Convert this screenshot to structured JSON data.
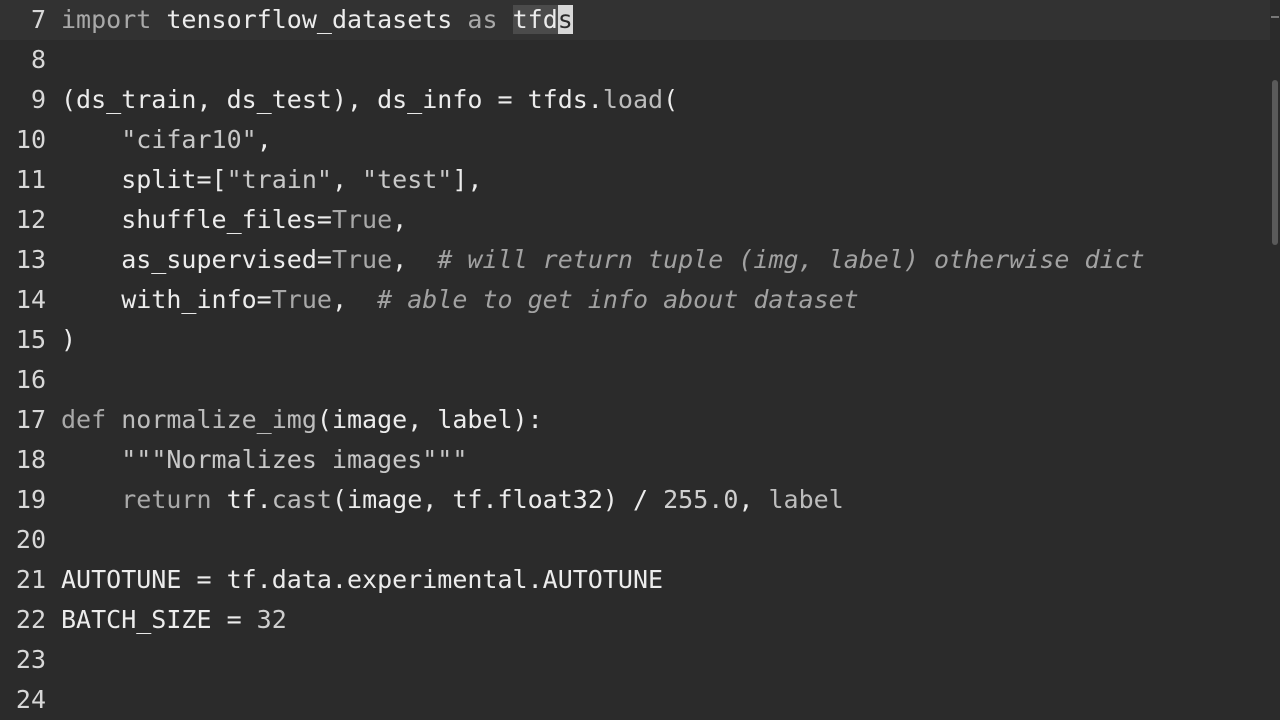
{
  "editor": {
    "language": "python",
    "caret_line": "7",
    "lines": [
      {
        "num": "7",
        "tokens": [
          {
            "t": "import",
            "c": "kw"
          },
          {
            "t": " ",
            "c": "id"
          },
          {
            "t": "tensorflow_datasets",
            "c": "id"
          },
          {
            "t": " ",
            "c": "id"
          },
          {
            "t": "as",
            "c": "kw"
          },
          {
            "t": " ",
            "c": "id"
          },
          {
            "t": "tfd",
            "c": "id sel-word"
          },
          {
            "t": "s",
            "c": "caret-box"
          }
        ]
      },
      {
        "num": "8",
        "tokens": []
      },
      {
        "num": "9",
        "tokens": [
          {
            "t": "(ds_train, ds_test), ds_info = tfds.",
            "c": "id"
          },
          {
            "t": "load",
            "c": "fn"
          },
          {
            "t": "(",
            "c": "id"
          }
        ]
      },
      {
        "num": "10",
        "tokens": [
          {
            "t": "    ",
            "c": "id"
          },
          {
            "t": "\"cifar10\"",
            "c": "str"
          },
          {
            "t": ",",
            "c": "id"
          }
        ]
      },
      {
        "num": "11",
        "tokens": [
          {
            "t": "    split=[",
            "c": "id"
          },
          {
            "t": "\"train\"",
            "c": "str"
          },
          {
            "t": ", ",
            "c": "id"
          },
          {
            "t": "\"test\"",
            "c": "str"
          },
          {
            "t": "],",
            "c": "id"
          }
        ]
      },
      {
        "num": "12",
        "tokens": [
          {
            "t": "    shuffle_files=",
            "c": "id"
          },
          {
            "t": "True",
            "c": "kw"
          },
          {
            "t": ",",
            "c": "id"
          }
        ]
      },
      {
        "num": "13",
        "tokens": [
          {
            "t": "    as_supervised=",
            "c": "id"
          },
          {
            "t": "True",
            "c": "kw"
          },
          {
            "t": ",  ",
            "c": "id"
          },
          {
            "t": "# will return tuple (img, label) otherwise dict",
            "c": "cm"
          }
        ]
      },
      {
        "num": "14",
        "tokens": [
          {
            "t": "    with_info=",
            "c": "id"
          },
          {
            "t": "True",
            "c": "kw"
          },
          {
            "t": ",  ",
            "c": "id"
          },
          {
            "t": "# able to get info about dataset",
            "c": "cm"
          }
        ]
      },
      {
        "num": "15",
        "tokens": [
          {
            "t": ")",
            "c": "id"
          }
        ]
      },
      {
        "num": "16",
        "tokens": []
      },
      {
        "num": "17",
        "tokens": [
          {
            "t": "def",
            "c": "kw"
          },
          {
            "t": " ",
            "c": "id"
          },
          {
            "t": "normalize_img",
            "c": "fn"
          },
          {
            "t": "(image, label):",
            "c": "id"
          }
        ]
      },
      {
        "num": "18",
        "tokens": [
          {
            "t": "    ",
            "c": "id"
          },
          {
            "t": "\"\"\"Normalizes images\"\"\"",
            "c": "str"
          }
        ]
      },
      {
        "num": "19",
        "tokens": [
          {
            "t": "    ",
            "c": "id"
          },
          {
            "t": "return",
            "c": "kw"
          },
          {
            "t": " tf.",
            "c": "id"
          },
          {
            "t": "cast",
            "c": "fn"
          },
          {
            "t": "(image, tf.float32) / ",
            "c": "id"
          },
          {
            "t": "255.0",
            "c": "num"
          },
          {
            "t": ", ",
            "c": "id"
          },
          {
            "t": "label",
            "c": "fn"
          }
        ]
      },
      {
        "num": "20",
        "tokens": []
      },
      {
        "num": "21",
        "tokens": [
          {
            "t": "AUTOTUNE = tf.data.experimental.AUTOTUNE",
            "c": "id"
          }
        ]
      },
      {
        "num": "22",
        "tokens": [
          {
            "t": "BATCH_SIZE = ",
            "c": "id"
          },
          {
            "t": "32",
            "c": "num"
          }
        ]
      },
      {
        "num": "23",
        "tokens": []
      },
      {
        "num": "24",
        "tokens": []
      }
    ]
  },
  "colors": {
    "background": "#2b2b2b",
    "current_line": "#323232",
    "text": "#ececec",
    "keyword": "#a9a9a9",
    "comment": "#a2a2a2"
  }
}
